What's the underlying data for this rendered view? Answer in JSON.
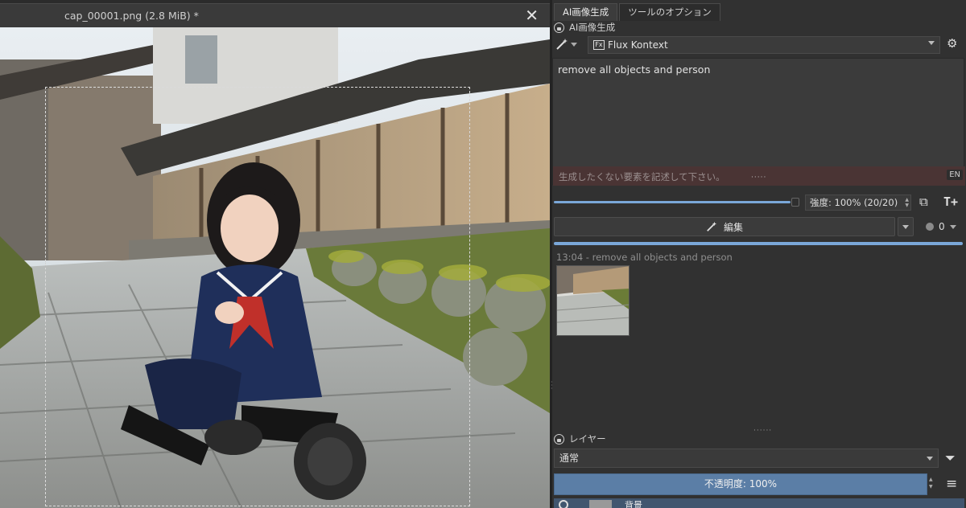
{
  "document": {
    "title": "cap_00001.png (2.8 MiB) *",
    "close_glyph": "✕"
  },
  "dock": {
    "tabs": [
      "AI画像生成",
      "ツールのオプション"
    ],
    "section_title": "AI画像生成",
    "model": {
      "label": "Flux Kontext",
      "badge": "Fx"
    },
    "prompt": "remove all objects and person",
    "negative_placeholder": "生成したくない要素を記述して下さい。",
    "language_badge": "EN",
    "strength": {
      "label": "強度: 100% (20/20)",
      "value_fraction": 1.0
    },
    "edit_button_label": "編集",
    "queue_count": "0",
    "history_label": "13:04 - remove all objects and person",
    "progress_fraction": 1.0
  },
  "layers": {
    "section_title": "レイヤー",
    "blend_mode": "通常",
    "opacity_label": "不透明度: 100%",
    "layer_name": "背景"
  },
  "icons": [
    "lock-icon",
    "magic-wand-icon",
    "gear-icon",
    "add-layer-icon",
    "text-insert-icon",
    "filter-icon",
    "menu-icon",
    "eye-icon",
    "close-icon"
  ],
  "colors": {
    "accent": "#7aa7d8",
    "opacity_bar": "#5b7ea6",
    "negative_prompt_bg": "#4a3434"
  }
}
